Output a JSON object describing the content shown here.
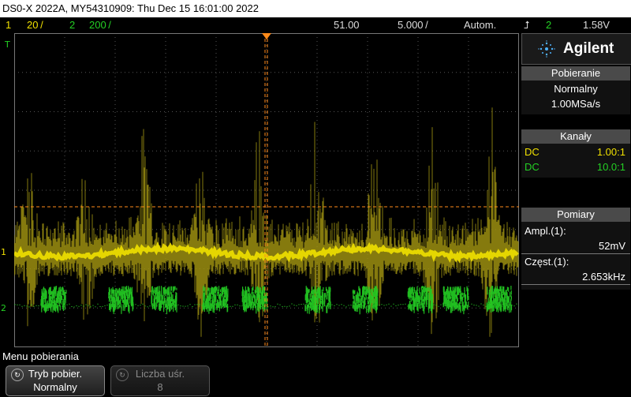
{
  "titlebar": {
    "text": "DS0-X 2022A, MY54310909: Thu Dec 15 16:01:00 2022"
  },
  "status": {
    "ch1_num": "1",
    "ch1_scale": "20 /",
    "ch2_num": "2",
    "ch2_scale": "200 /",
    "time_pos": "51.00",
    "time_scale": "5.000 /",
    "trigger_mode": "Autom.",
    "trigger_src": "2",
    "trigger_level": "1.58V"
  },
  "screen": {
    "ch1_marker": "1",
    "ch2_marker": "2",
    "trig_marker": "T",
    "colors": {
      "ch1": "#f0e000",
      "ch2": "#24d024",
      "cursor": "#ff8a1a",
      "grid": "#555555"
    }
  },
  "panel": {
    "brand": "Agilent",
    "acq_title": "Pobieranie",
    "acq_mode": "Normalny",
    "acq_rate": "1.00MSa/s",
    "chan_title": "Kanały",
    "chan1_coupling": "DC",
    "chan1_probe": "1.00:1",
    "chan2_coupling": "DC",
    "chan2_probe": "10.0:1",
    "meas_title": "Pomiary",
    "meas1_label": "Ampl.(1):",
    "meas1_value": "52mV",
    "meas2_label": "Częst.(1):",
    "meas2_value": "2.653kHz"
  },
  "menu": {
    "title": "Menu pobierania",
    "key1_top": "Tryb pobier.",
    "key1_bottom": "Normalny",
    "key2_top": "Liczba uśr.",
    "key2_bottom": "8"
  }
}
